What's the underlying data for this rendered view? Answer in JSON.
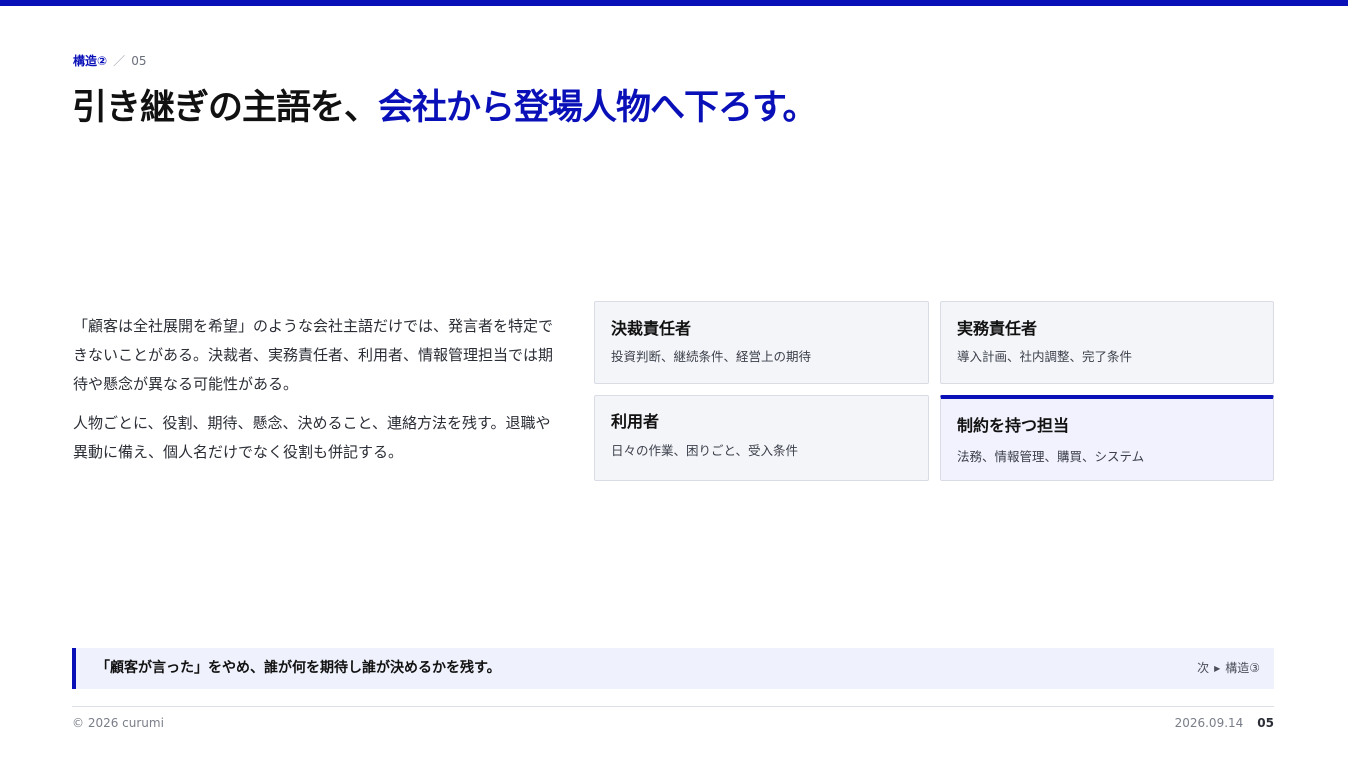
{
  "header": {
    "section": "構造②",
    "separator": "／",
    "page_ref": "05",
    "title_lead": "引き継ぎの主語を、",
    "title_accent": "会社から登場人物へ下ろす。"
  },
  "body": {
    "paragraphs": [
      "「顧客は全社展開を希望」のような会社主語だけでは、発言者を特定できないことがある。決裁者、実務責任者、利用者、情報管理担当では期待や懸念が異なる可能性がある。",
      "人物ごとに、役割、期待、懸念、決めること、連絡方法を残す。退職や異動に備え、個人名だけでなく役割も併記する。"
    ]
  },
  "cards": [
    {
      "name": "決裁責任者",
      "desc": "投資判断、継続条件、経営上の期待"
    },
    {
      "name": "実務責任者",
      "desc": "導入計画、社内調整、完了条件"
    },
    {
      "name": "利用者",
      "desc": "日々の作業、困りごと、受入条件"
    },
    {
      "name": "制約を持つ担当",
      "desc": "法務、情報管理、購買、システム",
      "highlighted": true
    }
  ],
  "callout": {
    "message": "「顧客が言った」をやめ、誰が何を期待し誰が決めるかを残す。",
    "next_label": "次",
    "next_arrow": "▶",
    "next_target": "構造③"
  },
  "footer": {
    "copyright": "© 2026 curumi",
    "date": "2026.09.14",
    "page": "05"
  },
  "colors": {
    "accent": "#0a10b8",
    "card_bg": "#f4f5f9",
    "callout_bg": "#eff1fc"
  }
}
